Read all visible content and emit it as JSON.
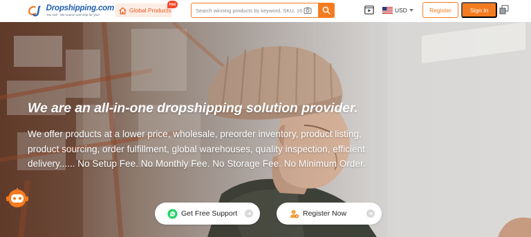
{
  "header": {
    "logo": {
      "name": "Dropshipping.com",
      "tagline": "You sell - We source and ship for you!"
    },
    "global_products": {
      "label": "Global Products",
      "badge": "Hot"
    },
    "search": {
      "placeholder": "Search winning products by keyword, SKU, 1688..."
    },
    "currency": "USD",
    "register_label": "Register",
    "signin_label": "Sign In"
  },
  "hero": {
    "title": "We are an all-in-one dropshipping solution provider.",
    "description": "We offer products at a lower price, wholesale, preorder inventory, product listing, product sourcing, order fulfillment, global warehouses, quality inspection, efficient delivery...... No Setup Fee. No Monthly Fee. No Storage Fee. No Minimum Order.",
    "buttons": {
      "support": "Get Free Support",
      "register": "Register Now"
    }
  },
  "colors": {
    "accent": "#f57b20",
    "brand_blue": "#1f5fb0",
    "badge_red": "#f24a2a",
    "whatsapp_green": "#25d366"
  },
  "icons": [
    "home-icon",
    "camera-icon",
    "search-icon",
    "video-icon",
    "us-flag-icon",
    "chevron-down-icon",
    "window-icon",
    "whatsapp-icon",
    "user-icon",
    "arrow-right-icon",
    "chatbot-icon"
  ]
}
